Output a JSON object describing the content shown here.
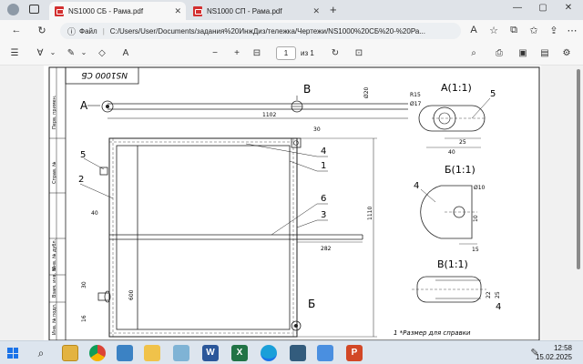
{
  "tabs": [
    {
      "title": "NS1000 СБ - Рама.pdf",
      "active": true
    },
    {
      "title": "NS1000 СП - Рама.pdf",
      "active": false
    }
  ],
  "address": {
    "label": "Файл",
    "url": "C:/Users/User/Documents/задания%20ИнжДиз/тележка/Чертежи/NS1000%20СБ%20-%20Ра..."
  },
  "pdf_toolbar": {
    "page_current": "1",
    "page_total": "из 1"
  },
  "drawing": {
    "stamp_text": "NS1000 СБ",
    "view_labels": [
      "A",
      "B",
      "Б"
    ],
    "view_a_title": "A(1:1)",
    "view_b_title": "Б(1:1)",
    "view_v_title": "В(1:1)",
    "note": "1 *Размер для справки",
    "callouts": [
      "1",
      "2",
      "3",
      "4",
      "5",
      "6"
    ],
    "dims": {
      "top_bar": "1102",
      "right_height": "1110",
      "middle": "282",
      "left_small": "40",
      "d_top": "Ø20",
      "r1": "R15",
      "d1": "Ø17",
      "w40": "40",
      "w25": "25",
      "d10": "Ø10",
      "h15": "15",
      "h10": "10",
      "v22": "22",
      "v25": "25",
      "left_30": "30",
      "left_600": "600",
      "left_16": "16",
      "top_30": "30",
      "frame_40": "40*"
    },
    "sidebar_labels": [
      "Перв. примен.",
      "Справ. №",
      "Подп. и дата",
      "Инв. № дубл.",
      "Взам. инв. №",
      "Подп. и дата",
      "Инв. № подл."
    ]
  },
  "taskbar": {
    "time": "12:58",
    "date": "15.02.2025"
  }
}
